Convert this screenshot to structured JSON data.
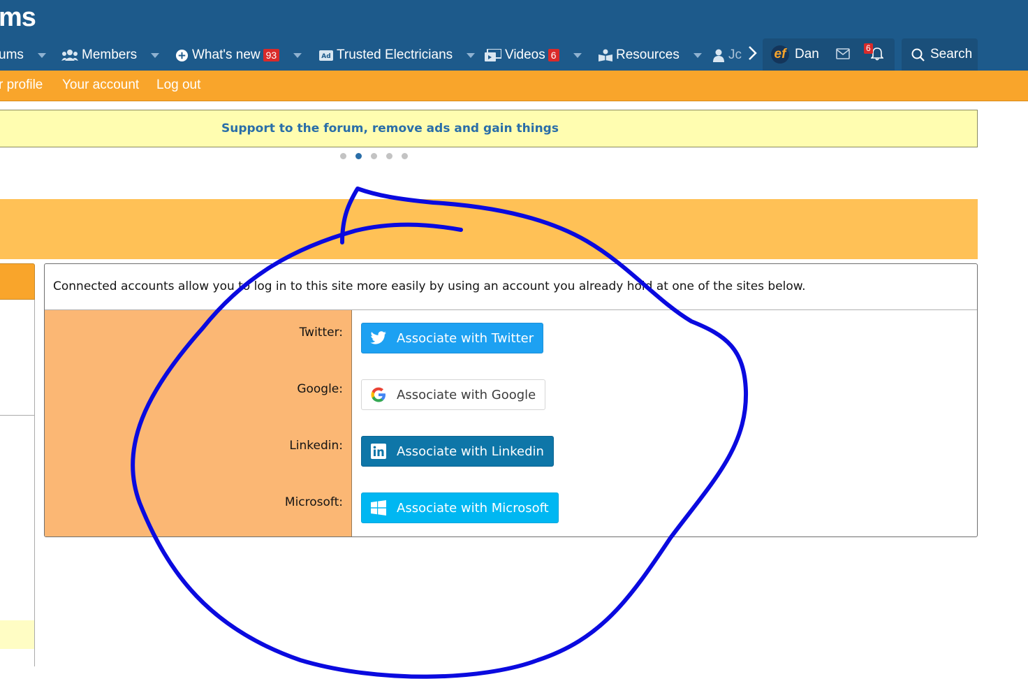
{
  "header": {
    "logo_text": "ms",
    "nav": [
      {
        "label": "ums",
        "icon": "forums-icon"
      },
      {
        "label": "Members",
        "icon": "members-icon"
      },
      {
        "label": "What's new",
        "icon": "plus-circle-icon",
        "badge": "93"
      },
      {
        "label": "Trusted Electricians",
        "icon": "ad-icon"
      },
      {
        "label": "Videos",
        "icon": "videos-icon",
        "badge": "6"
      },
      {
        "label": "Resources",
        "icon": "resources-icon"
      },
      {
        "label": "Jc",
        "icon": "user-icon"
      }
    ],
    "user_name": "Dan",
    "avatar_text": "ef",
    "alerts_badge": "6",
    "search_label": "Search"
  },
  "subnav": {
    "items": [
      "r profile",
      "Your account",
      "Log out"
    ]
  },
  "notice": {
    "text": "Support to the forum, remove ads and gain things",
    "dots": 5,
    "active_dot": 1
  },
  "connected_accounts": {
    "intro": "Connected accounts allow you to log in to this site more easily by using an account you already hold at one of the sites below.",
    "providers": [
      {
        "label": "Twitter:",
        "button": "Associate with Twitter",
        "icon": "twitter-icon"
      },
      {
        "label": "Google:",
        "button": "Associate with Google",
        "icon": "google-icon"
      },
      {
        "label": "Linkedin:",
        "button": "Associate with Linkedin",
        "icon": "linkedin-icon"
      },
      {
        "label": "Microsoft:",
        "button": "Associate with Microsoft",
        "icon": "microsoft-icon"
      }
    ]
  },
  "colors": {
    "header_bg": "#1d5a8b",
    "subnav_bg": "#f9a52b",
    "annotation_stroke": "#0a0adf"
  }
}
